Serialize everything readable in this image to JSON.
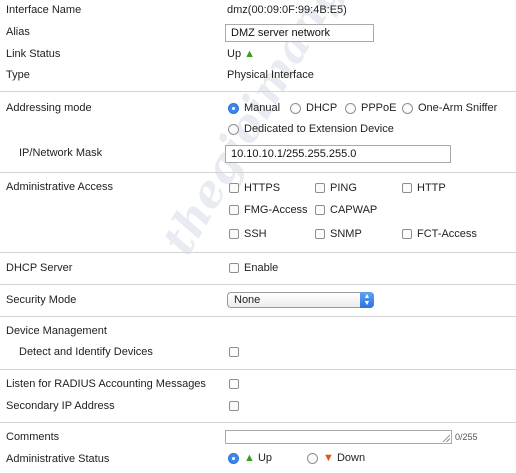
{
  "interface": {
    "name_label": "Interface Name",
    "name_value": "dmz(00:09:0F:99:4B:E5)",
    "alias_label": "Alias",
    "alias_value": "DMZ server network",
    "link_status_label": "Link Status",
    "link_status_value": "Up",
    "type_label": "Type",
    "type_value": "Physical Interface"
  },
  "addressing": {
    "label": "Addressing mode",
    "options": [
      "Manual",
      "DHCP",
      "PPPoE",
      "One-Arm Sniffer",
      "Dedicated to Extension Device"
    ],
    "selected": "Manual",
    "ip_label": "IP/Network Mask",
    "ip_value": "10.10.10.1/255.255.255.0"
  },
  "admin_access": {
    "label": "Administrative Access",
    "options": [
      "HTTPS",
      "PING",
      "HTTP",
      "FMG-Access",
      "CAPWAP",
      "SSH",
      "SNMP",
      "FCT-Access"
    ]
  },
  "dhcp": {
    "label": "DHCP Server",
    "enable_label": "Enable"
  },
  "security": {
    "label": "Security Mode",
    "value": "None"
  },
  "device_mgmt": {
    "label": "Device Management",
    "detect_label": "Detect and Identify Devices"
  },
  "radius": {
    "label": "Listen for RADIUS Accounting Messages"
  },
  "secondary_ip": {
    "label": "Secondary IP Address"
  },
  "comments": {
    "label": "Comments",
    "value": "",
    "counter": "0/255"
  },
  "admin_status": {
    "label": "Administrative Status",
    "up_label": "Up",
    "down_label": "Down",
    "selected": "Up"
  },
  "watermark": "thegioimang.vn",
  "colors": {
    "accent": "#3b87ea",
    "status_up": "#3a9d23",
    "status_down": "#e0561d",
    "separator": "#d4d4d4"
  }
}
